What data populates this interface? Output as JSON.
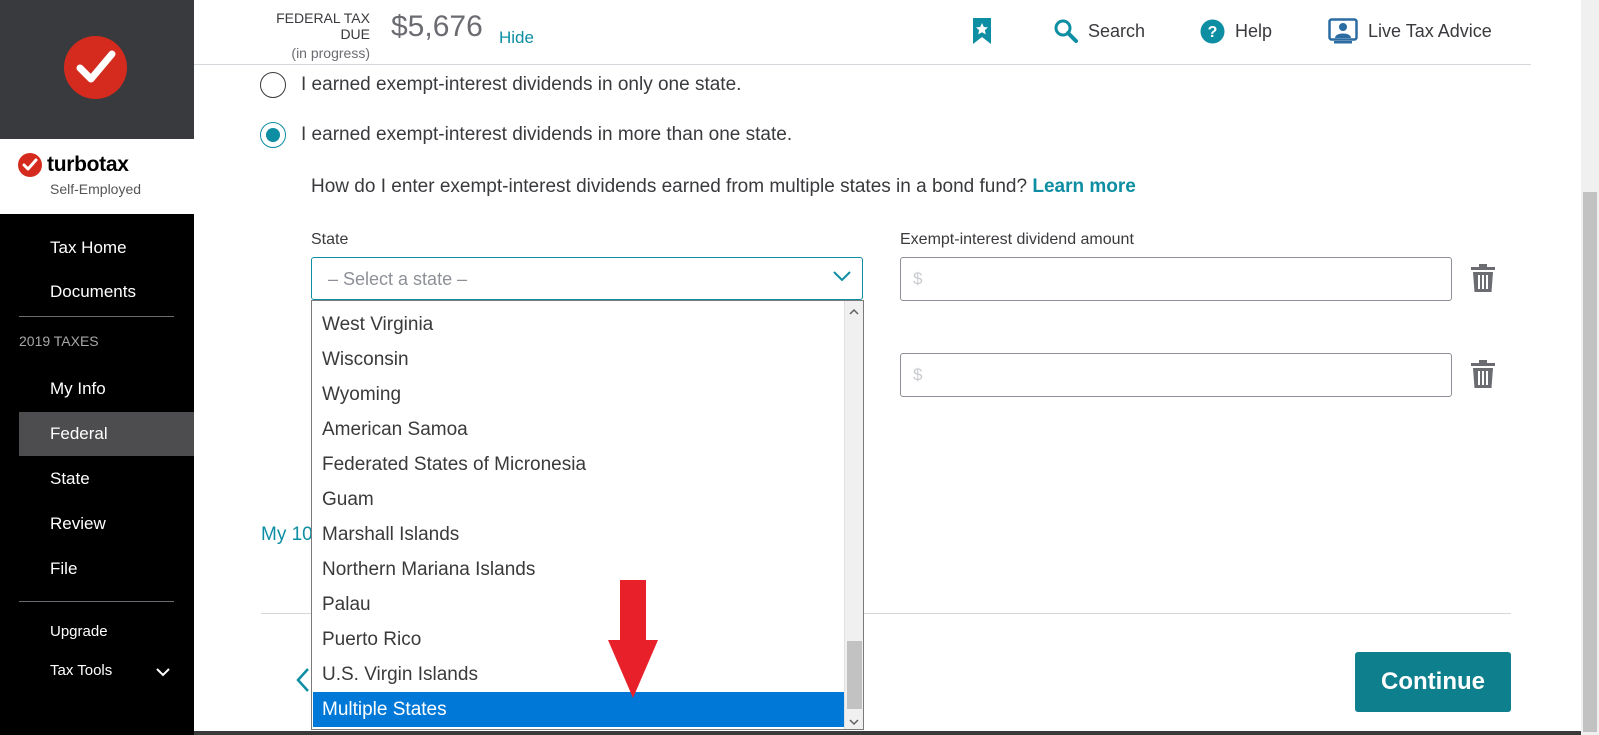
{
  "brand": {
    "name": "turbotax",
    "edition": "Self-Employed"
  },
  "sidebar": {
    "items_top": [
      {
        "label": "Tax Home"
      },
      {
        "label": "Documents"
      }
    ],
    "section_label": "2019 TAXES",
    "items": [
      {
        "label": "My Info"
      },
      {
        "label": "Federal"
      },
      {
        "label": "State"
      },
      {
        "label": "Review"
      },
      {
        "label": "File"
      }
    ],
    "items_bottom": [
      {
        "label": "Upgrade"
      },
      {
        "label": "Tax Tools"
      }
    ]
  },
  "header": {
    "tax_due_label": "FEDERAL TAX DUE",
    "tax_due_status": "(in progress)",
    "tax_due_amount": "$5,676",
    "hide_label": "Hide",
    "search_label": "Search",
    "help_label": "Help",
    "live_advice_label": "Live Tax Advice"
  },
  "main": {
    "radio_one_state": "I earned exempt-interest dividends in only one state.",
    "radio_multi_state": "I earned exempt-interest dividends in more than one state.",
    "help_question": "How do I enter exempt-interest dividends earned from multiple states in a bond fund?",
    "learn_more": "Learn more",
    "state_label": "State",
    "state_placeholder": "– Select a state –",
    "amount_label": "Exempt-interest dividend amount",
    "amount_placeholder": "$",
    "partial_link": "My 10",
    "continue_label": "Continue"
  },
  "dropdown": {
    "options": [
      "West Virginia",
      "Wisconsin",
      "Wyoming",
      "American Samoa",
      "Federated States of Micronesia",
      "Guam",
      "Marshall Islands",
      "Northern Mariana Islands",
      "Palau",
      "Puerto Rico",
      "U.S. Virgin Islands",
      "Multiple States"
    ],
    "selected": "Multiple States"
  },
  "colors": {
    "accent": "#0d8ea2",
    "brand_red": "#d52b1e",
    "selection_blue": "#0078d7",
    "annotation_arrow": "#e8202a"
  }
}
